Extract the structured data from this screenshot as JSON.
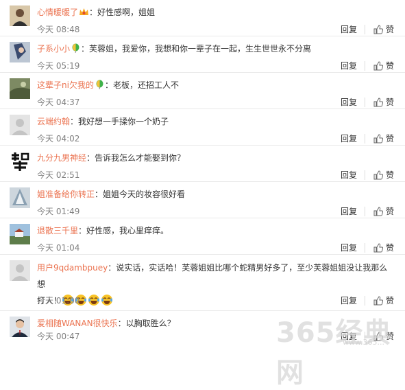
{
  "actions": {
    "reply": "回复",
    "like": "赞"
  },
  "comments": [
    {
      "user": "心情暖暖了",
      "badge": "crown-badge",
      "text": "：好性感啊，姐姐",
      "time": "今天 08:48"
    },
    {
      "user": "子系小小",
      "badge": "balloon-badge",
      "text": "：芙蓉姐，我爱你，我想和你一辈子在一起，生生世世永不分离",
      "time": "今天 05:19"
    },
    {
      "user": "这辈子ni欠我的",
      "badge": "balloon-badge",
      "text": "：老板，还招工人不",
      "time": "今天 04:37"
    },
    {
      "user": "云端约翰",
      "text": "：我好想一手揉你一个奶子",
      "time": "今天 04:02"
    },
    {
      "user": "九分九男神经",
      "text": "：告诉我怎么才能娶到你？",
      "time": "今天 02:51"
    },
    {
      "user": "姐准备给你转正",
      "text": "：姐姐今天的妆容很好看",
      "time": "今天 01:49"
    },
    {
      "user": "退散三千里",
      "text": "：好性感，我心里痒痒。",
      "time": "今天 01:04"
    },
    {
      "user": "用户9qdambpuey",
      "text": "：说实话，实话哈！芙蓉姐姐比哪个蛇精男好多了，至少芙蓉姐姐没让我那么想",
      "text2": "打人！",
      "emoji": "laughing-tears-emoji",
      "time": "今天 01:00"
    },
    {
      "user": "爱相随WANAN很快乐",
      "text": "：以胸取胜么？",
      "time": "今天 00:47"
    }
  ],
  "watermark": {
    "text": "365经典网",
    "url": "www.365..."
  },
  "colors": {
    "username": "#eb7350",
    "time": "#808080",
    "text": "#333333"
  }
}
